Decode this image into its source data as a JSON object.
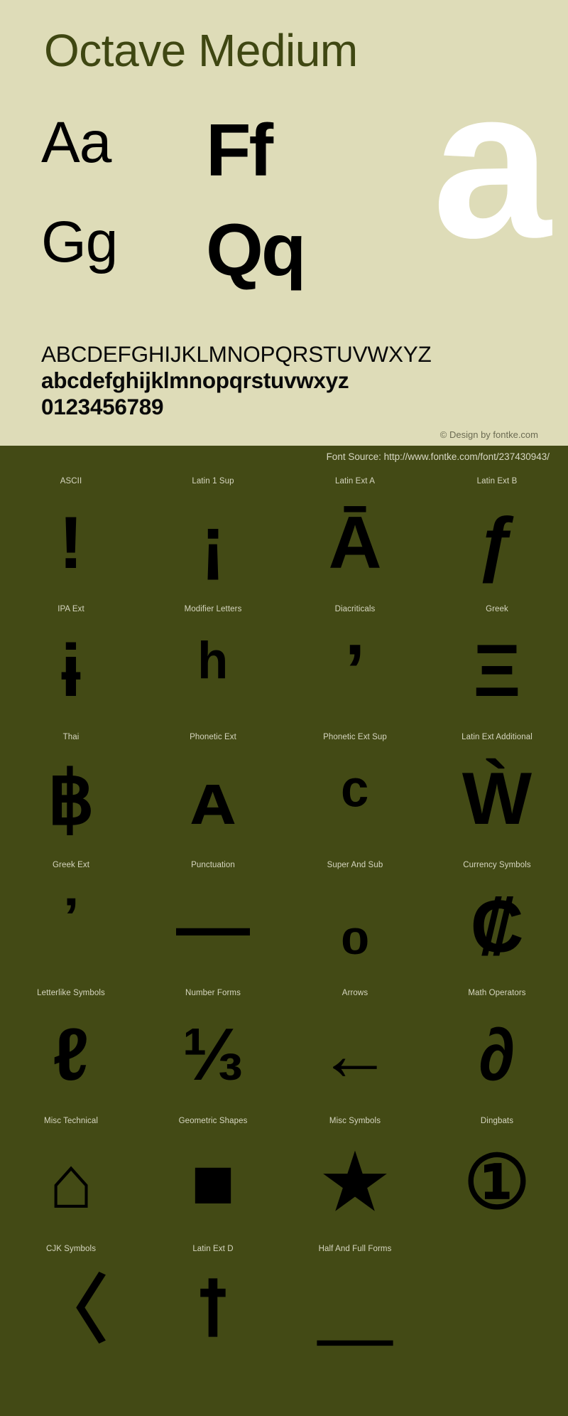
{
  "colors": {
    "panel_light_bg": "#dedcb8",
    "panel_dark_bg": "#434a15",
    "title": "#3f4712",
    "glyph_black": "#000000",
    "showcase_white": "#ffffff",
    "label_light": "#d6d6c0",
    "copyright": "#6b6b52"
  },
  "header": {
    "font_name": "Octave Medium"
  },
  "showcase": {
    "big_letter": "a",
    "pairs": [
      {
        "text": "Aa"
      },
      {
        "text": "Ff"
      },
      {
        "text": "Gg"
      },
      {
        "text": "Qq"
      }
    ]
  },
  "alphabet": {
    "uppercase": "ABCDEFGHIJKLMNOPQRSTUVWXYZ",
    "lowercase": "abcdefghijklmnopqrstuvwxyz",
    "digits": "0123456789"
  },
  "credits": {
    "copyright": "© Design by fontke.com",
    "font_source": "Font Source: http://www.fontke.com/font/237430943/"
  },
  "unicode_blocks": [
    {
      "label": "ASCII",
      "glyph": "!",
      "size": 104
    },
    {
      "label": "Latin 1 Sup",
      "glyph": "¡",
      "size": 104
    },
    {
      "label": "Latin Ext A",
      "glyph": "Ā",
      "size": 104
    },
    {
      "label": "Latin Ext B",
      "glyph": "ƒ",
      "size": 104
    },
    {
      "label": "IPA Ext",
      "glyph": "ɨ",
      "size": 104
    },
    {
      "label": "Modifier Letters",
      "glyph": "ʰ",
      "size": 104
    },
    {
      "label": "Diacriticals",
      "glyph": "̓",
      "size": 104
    },
    {
      "label": "Greek",
      "glyph": "Ξ",
      "size": 104
    },
    {
      "label": "Thai",
      "glyph": "฿",
      "size": 104
    },
    {
      "label": "Phonetic Ext",
      "glyph": "ᴀ",
      "size": 104
    },
    {
      "label": "Phonetic Ext Sup",
      "glyph": "ᶜ",
      "size": 104
    },
    {
      "label": "Latin Ext Additional",
      "glyph": "Ẁ",
      "size": 104
    },
    {
      "label": "Greek Ext",
      "glyph": "᾽",
      "size": 104
    },
    {
      "label": "Punctuation",
      "glyph": "—",
      "size": 104
    },
    {
      "label": "Super And Sub",
      "glyph": "₀",
      "size": 104
    },
    {
      "label": "Currency Symbols",
      "glyph": "₡",
      "size": 104
    },
    {
      "label": "Letterlike Symbols",
      "glyph": "ℓ",
      "size": 104
    },
    {
      "label": "Number Forms",
      "glyph": "⅓",
      "size": 104
    },
    {
      "label": "Arrows",
      "glyph": "←",
      "size": 104
    },
    {
      "label": "Math Operators",
      "glyph": "∂",
      "size": 104
    },
    {
      "label": "Misc Technical",
      "glyph": "⌂",
      "size": 104
    },
    {
      "label": "Geometric Shapes",
      "glyph": "■",
      "size": 104
    },
    {
      "label": "Misc Symbols",
      "glyph": "★",
      "size": 104
    },
    {
      "label": "Dingbats",
      "glyph": "①",
      "size": 104
    },
    {
      "label": "CJK Symbols",
      "glyph": "〈",
      "size": 104
    },
    {
      "label": "Latin Ext D",
      "glyph": "ꝉ",
      "size": 104
    },
    {
      "label": "Half And Full Forms",
      "glyph": "＿",
      "size": 104
    }
  ]
}
